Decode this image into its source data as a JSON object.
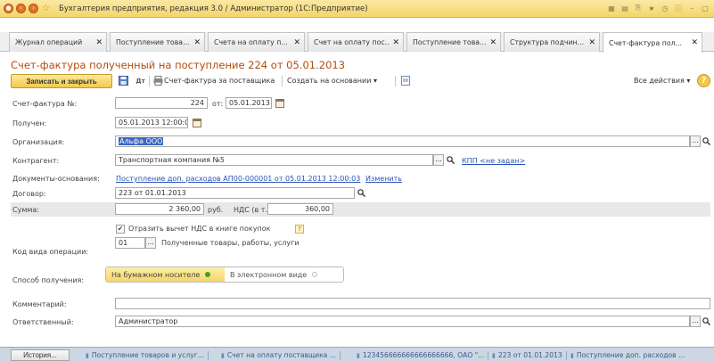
{
  "window": {
    "title": "Бухгалтерия предприятия, редакция 3.0 / Администратор (1С:Предприятие)"
  },
  "tabs": [
    {
      "label": "Журнал операций",
      "active": false
    },
    {
      "label": "Поступление това...",
      "active": false
    },
    {
      "label": "Счета на оплату п...",
      "active": false
    },
    {
      "label": "Счет на оплату пос...",
      "active": false
    },
    {
      "label": "Поступление това...",
      "active": false
    },
    {
      "label": "Структура подчин...",
      "active": false
    },
    {
      "label": "Счет-фактура пол...",
      "active": true
    }
  ],
  "document": {
    "title": "Счет-фактура полученный на поступление 224 от 05.01.2013"
  },
  "toolbar": {
    "save_close_label": "Записать и закрыть",
    "print_label": "Счет-фактура за поставщика",
    "create_based_label": "Создать на основании ▾",
    "all_actions_label": "Все действия ▾"
  },
  "form": {
    "invoice_number_label": "Счет-фактура №:",
    "invoice_number": "224",
    "from_label": "от:",
    "invoice_date": "05.01.2013",
    "received_label": "Получен:",
    "received_date": "05.01.2013 12:00:04",
    "organization_label": "Организация:",
    "organization": "Альфа ООО",
    "counterparty_label": "Контрагент:",
    "counterparty": "Транспортная компания №5",
    "kpp_link": "КПП <не задан>",
    "base_docs_label": "Документы-основания:",
    "base_doc_link": "Поступление доп. расходов АП00-000001 от 05.01.2013 12:00:03",
    "change_link": "Изменить",
    "contract_label": "Договор:",
    "contract": "223 от 01.01.2013",
    "sum_label": "Сумма:",
    "sum": "2 360,00",
    "currency": "руб.",
    "vat_label": "НДС (в т.ч.):",
    "vat": "360,00",
    "reflect_vat_label": "Отразить вычет НДС в книге покупок",
    "reflect_vat_checked": true,
    "op_code_label": "Код вида операции:",
    "op_code": "01",
    "op_code_desc": "Полученные товары, работы, услуги",
    "receive_method_label": "Способ получения:",
    "receive_paper": "На бумажном носителе",
    "receive_electronic": "В электронном виде",
    "comment_label": "Комментарий:",
    "comment": "",
    "responsible_label": "Ответственный:",
    "responsible": "Администратор"
  },
  "bottom": {
    "history_label": "История...",
    "open_windows": [
      "Поступление товаров и услуг...",
      "Счет на оплату поставщика ...",
      "123456666666666666666, ОАО \"...",
      "223 от 01.01.2013",
      "Поступление доп. расходов ..."
    ]
  },
  "colors": {
    "accent_title": "#b24d0c",
    "primary_button": "#f2c94c",
    "link": "#2a54b5",
    "selection": "#3a66c3"
  }
}
